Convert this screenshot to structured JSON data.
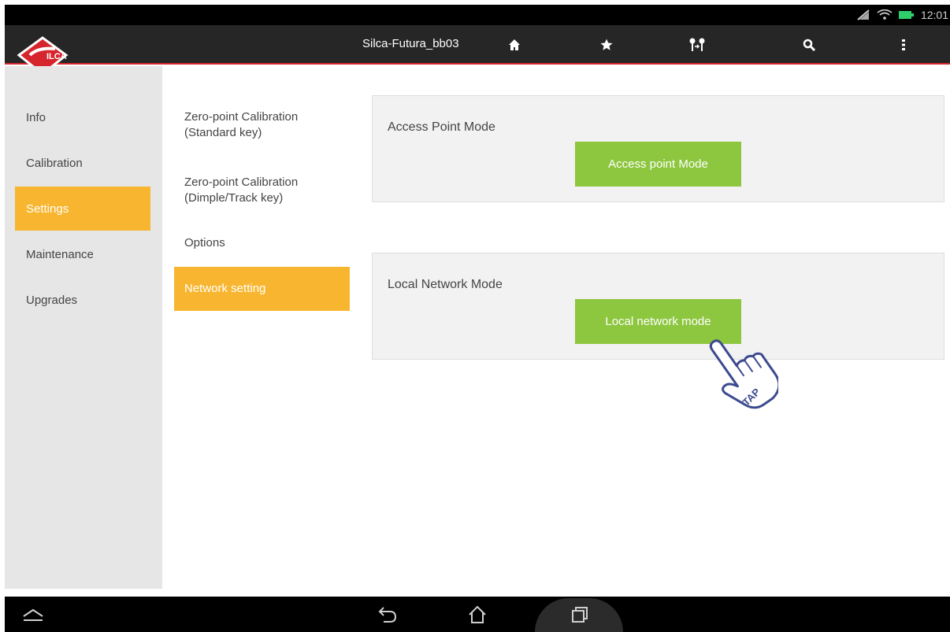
{
  "status": {
    "time": "12:01"
  },
  "appbar": {
    "title": "Silca-Futura_bb03",
    "logo_text": "SILCA",
    "icons": [
      "home-icon",
      "star-icon",
      "keys-icon",
      "search-icon",
      "more-vert-icon"
    ]
  },
  "sidebar": {
    "items": [
      {
        "label": "Info",
        "active": false
      },
      {
        "label": "Calibration",
        "active": false
      },
      {
        "label": "Settings",
        "active": true
      },
      {
        "label": "Maintenance",
        "active": false
      },
      {
        "label": "Upgrades",
        "active": false
      }
    ]
  },
  "submenu": {
    "items": [
      {
        "label": "Zero-point Calibration\n(Standard key)",
        "active": false
      },
      {
        "label": "Zero-point Calibration\n(Dimple/Track key)",
        "active": false
      },
      {
        "label": "Options",
        "active": false
      },
      {
        "label": "Network setting",
        "active": true
      }
    ]
  },
  "panels": {
    "access_point": {
      "title": "Access Point Mode",
      "button": "Access point Mode"
    },
    "local_network": {
      "title": "Local Network Mode",
      "button": "Local network mode"
    }
  },
  "overlay": {
    "tap_text": "TAP"
  },
  "colors": {
    "accent": "#f8b630",
    "button": "#8dc63f",
    "appbar": "#262626",
    "brand_red": "#d6252c"
  },
  "navbar": {
    "icons": [
      "chevron-up-icon",
      "back-icon",
      "home-outline-icon",
      "recents-icon"
    ]
  }
}
